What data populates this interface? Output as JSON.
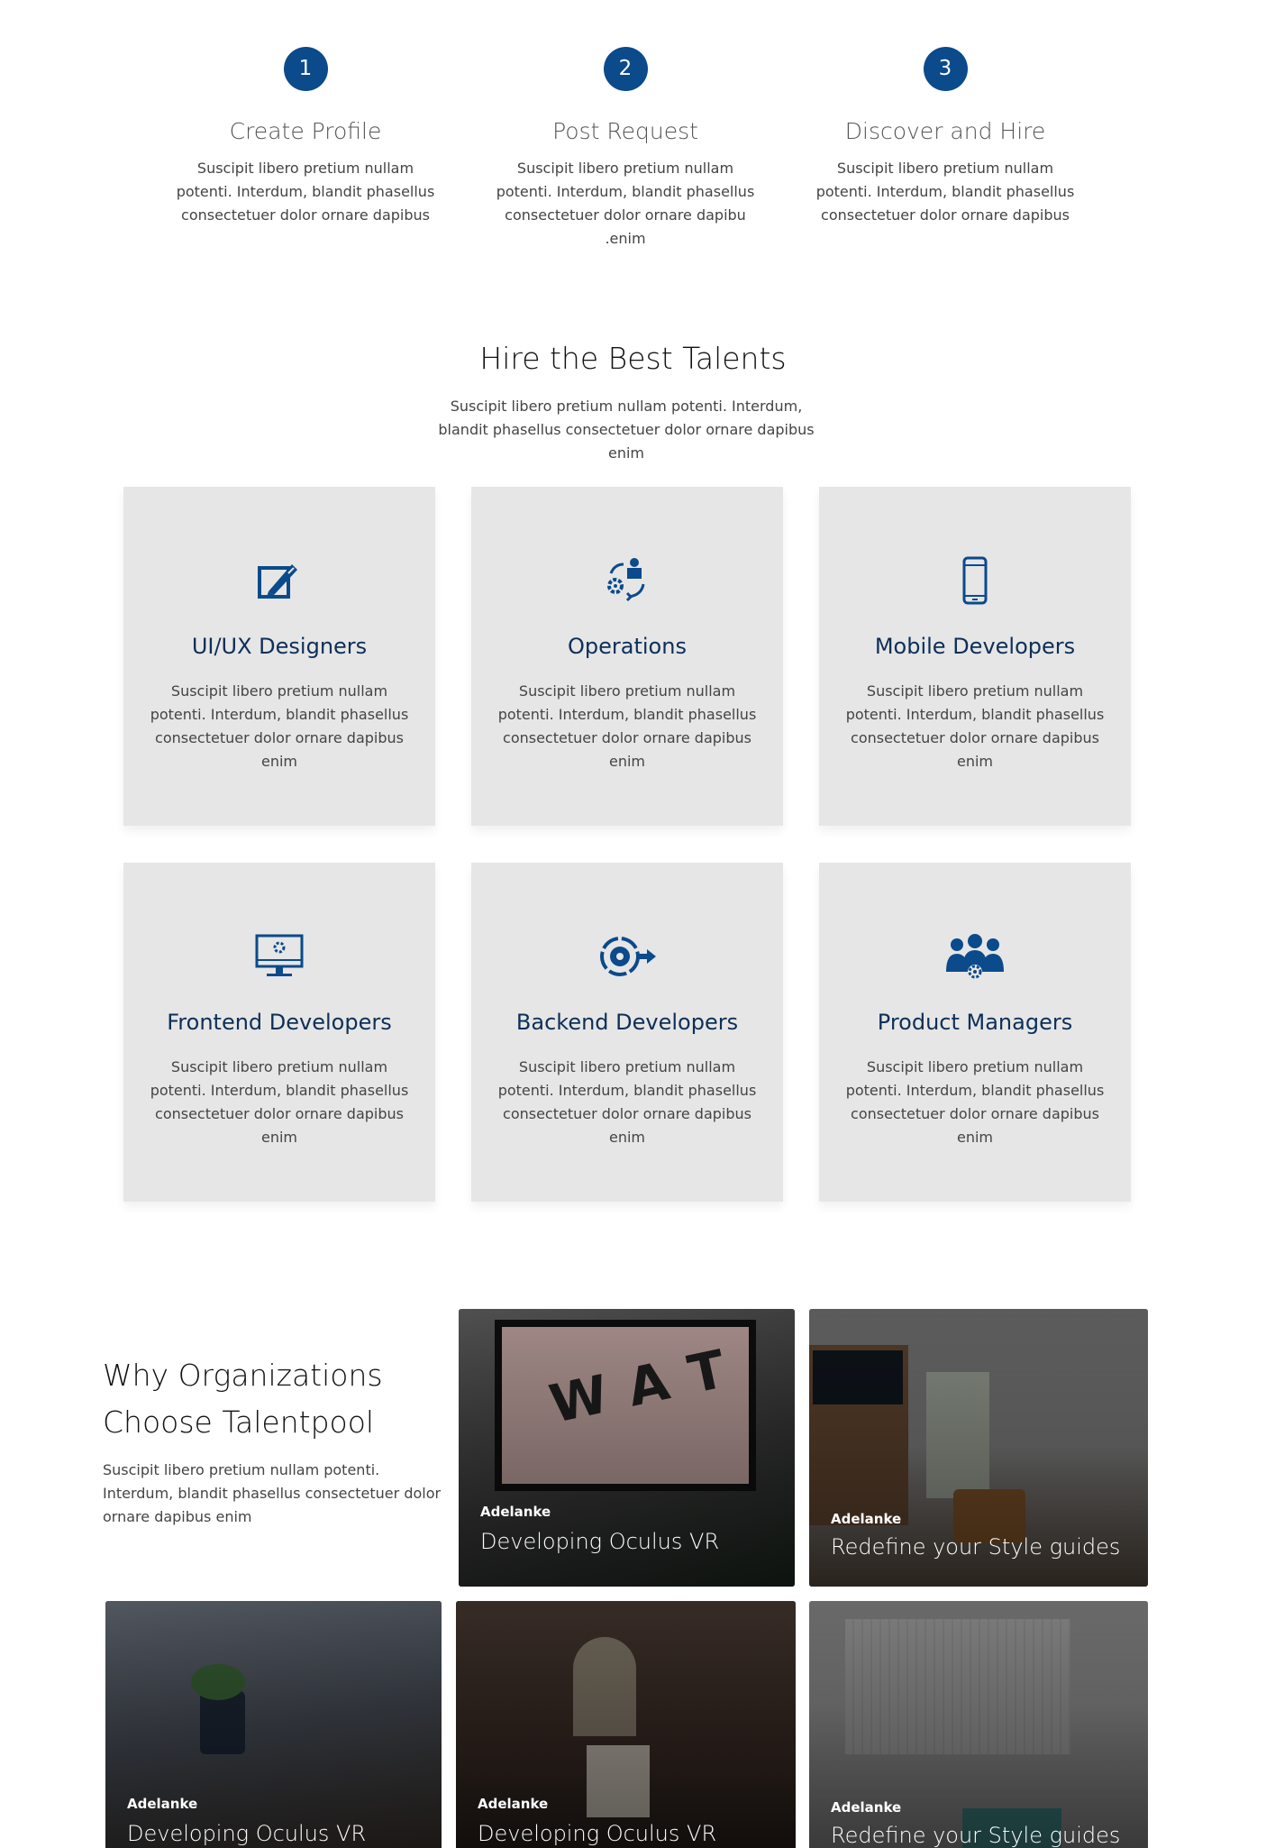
{
  "steps": [
    {
      "number": "1",
      "title": "Create Profile",
      "desc": "Suscipit libero pretium nullam potenti. Interdum, blandit phasellus consectetuer dolor ornare dapibus"
    },
    {
      "number": "2",
      "title": "Post Request",
      "desc": "Suscipit libero pretium nullam potenti. Interdum, blandit phasellus consectetuer dolor ornare dapibu .enim"
    },
    {
      "number": "3",
      "title": "Discover and Hire",
      "desc": "Suscipit libero pretium nullam potenti. Interdum, blandit phasellus consectetuer dolor ornare dapibus"
    }
  ],
  "talents": {
    "title": "Hire the Best Talents",
    "subtitle": "Suscipit libero pretium nullam potenti. Interdum, blandit phasellus consectetuer dolor ornare dapibus enim",
    "cards": [
      {
        "title": "UI/UX Designers",
        "icon": "design-pen-icon",
        "desc": "Suscipit libero pretium nullam potenti. Interdum, blandit phasellus consectetuer dolor ornare dapibus enim"
      },
      {
        "title": "Operations",
        "icon": "operations-icon",
        "desc": "Suscipit libero pretium nullam potenti. Interdum, blandit phasellus consectetuer dolor ornare dapibus enim"
      },
      {
        "title": "Mobile Developers",
        "icon": "mobile-phone-icon",
        "desc": "Suscipit libero pretium nullam potenti. Interdum, blandit phasellus consectetuer dolor ornare dapibus enim"
      },
      {
        "title": "Frontend Developers",
        "icon": "monitor-gear-icon",
        "desc": "Suscipit libero pretium nullam potenti. Interdum, blandit phasellus consectetuer dolor ornare dapibus enim"
      },
      {
        "title": "Backend Developers",
        "icon": "gear-arrow-icon",
        "desc": "Suscipit libero pretium nullam potenti. Interdum, blandit phasellus consectetuer dolor ornare dapibus enim"
      },
      {
        "title": "Product Managers",
        "icon": "team-gear-icon",
        "desc": "Suscipit libero pretium nullam potenti. Interdum, blandit phasellus consectetuer dolor ornare dapibus enim"
      }
    ]
  },
  "why": {
    "title_line1": "Why Organizations",
    "title_line2": "Choose Talentpool",
    "desc": "Suscipit libero pretium nullam potenti. Interdum, blandit phasellus consectetuer dolor ornare dapibus enim"
  },
  "posts": [
    {
      "author": "Adelanke",
      "title": "Developing Oculus VR"
    },
    {
      "author": "Adelanke",
      "title": "Redefine your Style guides"
    },
    {
      "author": "Adelanke",
      "title": "Developing Oculus VR"
    },
    {
      "author": "Adelanke",
      "title": "Developing Oculus VR"
    },
    {
      "author": "Adelanke",
      "title": "Redefine your Style guides"
    }
  ],
  "colors": {
    "accent": "#0b4a8b",
    "card_bg": "#e6e6e6",
    "card_title": "#0d2f57"
  }
}
